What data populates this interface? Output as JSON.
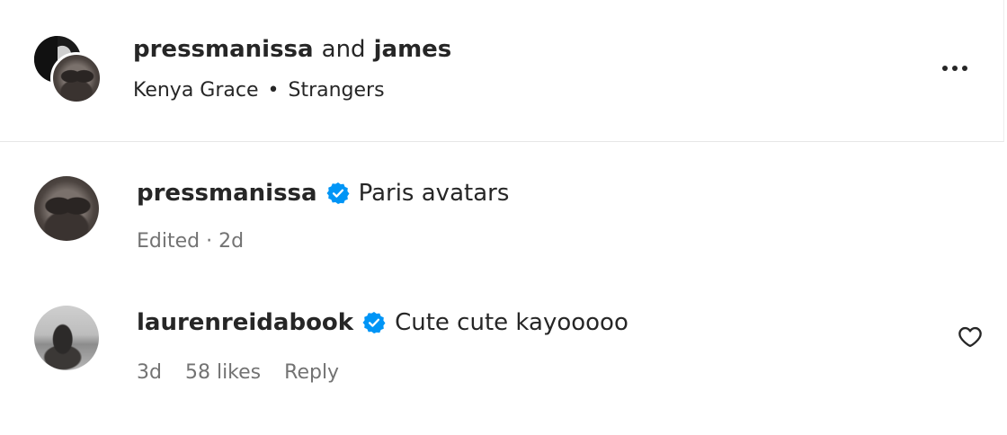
{
  "header": {
    "user_primary": "pressmanissa",
    "joiner": "and",
    "user_secondary": "james",
    "artist": "Kenya Grace",
    "separator": "•",
    "song": "Strangers",
    "more_icon": "more-horizontal-icon"
  },
  "comments": [
    {
      "username": "pressmanissa",
      "verified": true,
      "text": "Paris avatars",
      "meta": "Edited · 2d"
    },
    {
      "username": "laurenreidabook",
      "verified": true,
      "text": "Cute cute kayooooo",
      "time": "3d",
      "likes": "58 likes",
      "reply_label": "Reply",
      "like_icon": "heart-outline-icon"
    }
  ],
  "colors": {
    "primary_text": "#262626",
    "secondary_text": "#737373",
    "verified_blue": "#0095f6",
    "divider": "#e6e6e6"
  }
}
